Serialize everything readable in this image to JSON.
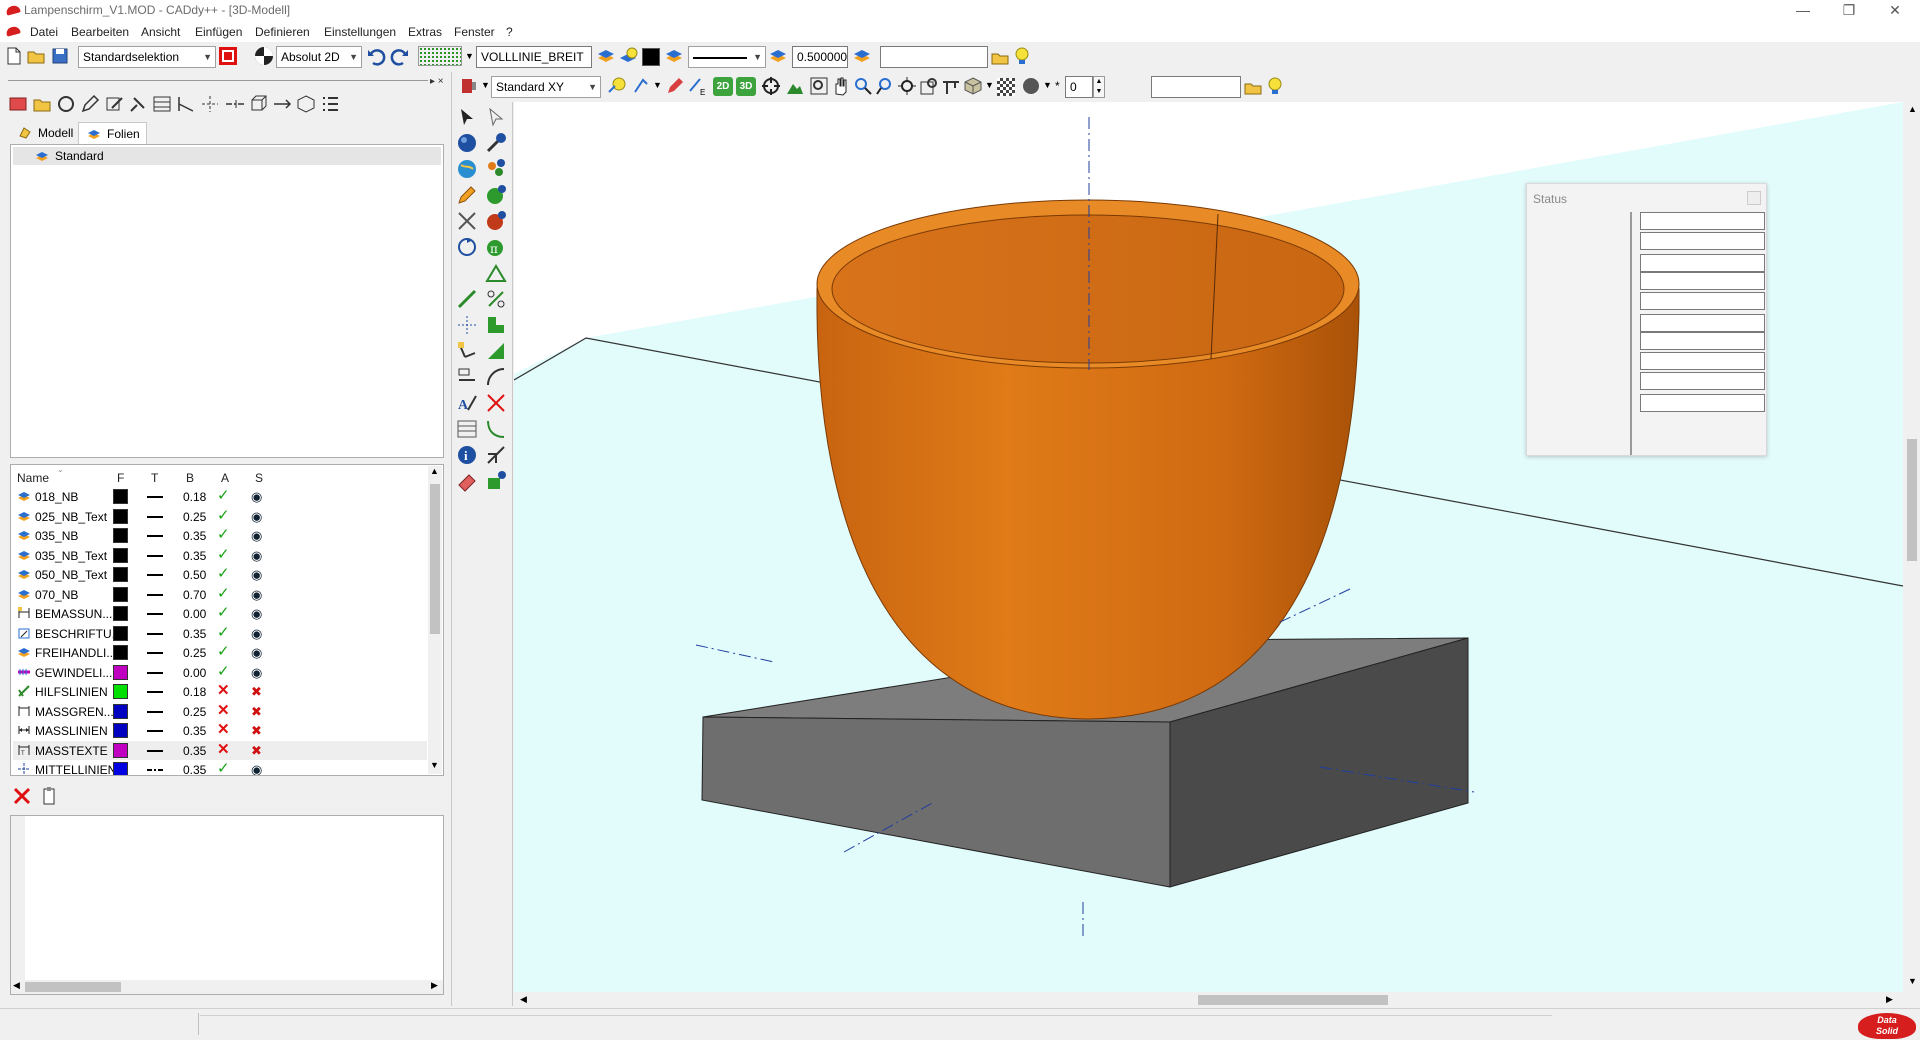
{
  "window": {
    "title": "Lampenschirm_V1.MOD  -  CADdy++ - [3D-Modell]",
    "minimize": "—",
    "restore": "❐",
    "close": "✕"
  },
  "menu": [
    "Datei",
    "Bearbeiten",
    "Ansicht",
    "Einfügen",
    "Definieren",
    "Einstellungen",
    "Extras",
    "Fenster",
    "?"
  ],
  "toolbar1": {
    "selection_mode": "Standardselektion",
    "coord_mode": "Absolut 2D",
    "line_style_name": "VOLLLINIE_BREIT",
    "line_width": "0.500000",
    "search_value": ""
  },
  "toolbar2": {
    "view": "Standard XY",
    "badge_2d": "2D",
    "badge_3d": "3D",
    "spin_value": "0",
    "text_value": ""
  },
  "left_panel": {
    "tabs": [
      "Modell",
      "Folien"
    ],
    "active_tab": "Folien",
    "tree_items": [
      "Standard"
    ],
    "columns": [
      "Name",
      "F",
      "T",
      "B",
      "A",
      "S"
    ],
    "layers": [
      {
        "name": "018_NB",
        "color": "#000000",
        "width": "0.18",
        "active": true,
        "visible": true,
        "icon": "layer-icon"
      },
      {
        "name": "025_NB_Text",
        "color": "#000000",
        "width": "0.25",
        "active": true,
        "visible": true,
        "icon": "layer-icon"
      },
      {
        "name": "035_NB",
        "color": "#000000",
        "width": "0.35",
        "active": true,
        "visible": true,
        "icon": "layer-icon"
      },
      {
        "name": "035_NB_Text",
        "color": "#000000",
        "width": "0.35",
        "active": true,
        "visible": true,
        "icon": "layer-icon"
      },
      {
        "name": "050_NB_Text",
        "color": "#000000",
        "width": "0.50",
        "active": true,
        "visible": true,
        "icon": "layer-icon"
      },
      {
        "name": "070_NB",
        "color": "#000000",
        "width": "0.70",
        "active": true,
        "visible": true,
        "icon": "layer-icon"
      },
      {
        "name": "BEMASSUN...",
        "color": "#000000",
        "width": "0.00",
        "active": true,
        "visible": true,
        "icon": "dimension-icon"
      },
      {
        "name": "BESCHRIFTU...",
        "color": "#000000",
        "width": "0.35",
        "active": true,
        "visible": true,
        "icon": "label-icon"
      },
      {
        "name": "FREIHANDLI...",
        "color": "#000000",
        "width": "0.25",
        "active": true,
        "visible": true,
        "icon": "layer-icon"
      },
      {
        "name": "GEWINDELI...",
        "color": "#c000c0",
        "width": "0.00",
        "active": true,
        "visible": true,
        "icon": "thread-icon"
      },
      {
        "name": "HILFSLINIEN",
        "color": "#00e000",
        "width": "0.18",
        "active": false,
        "visible": false,
        "icon": "helpline-icon"
      },
      {
        "name": "MASSGREN...",
        "color": "#0000c0",
        "width": "0.25",
        "active": false,
        "visible": false,
        "icon": "dimension-limit-icon"
      },
      {
        "name": "MASSLINIEN",
        "color": "#0000c0",
        "width": "0.35",
        "active": false,
        "visible": false,
        "icon": "dimension-line-icon"
      },
      {
        "name": "MASSTEXTE",
        "color": "#c000c0",
        "width": "0.35",
        "active": false,
        "visible": false,
        "icon": "dimension-text-icon"
      },
      {
        "name": "MITTELLINIEN",
        "color": "#0000e0",
        "width": "0.35",
        "active": true,
        "visible": true,
        "icon": "centerline-icon"
      }
    ]
  },
  "status_panel": {
    "title": "Status"
  },
  "brand": {
    "line1": "Data",
    "line2": "Solid"
  },
  "colors": {
    "bowl_light": "#e07b18",
    "bowl_dark": "#9c4a08",
    "base_top": "#7d7d7d",
    "base_front": "#5c5c5c",
    "base_side": "#4a4a4a",
    "workplane": "#e2fbfb",
    "axis": "#1f3f9e",
    "brand_red": "#d61e1e"
  }
}
